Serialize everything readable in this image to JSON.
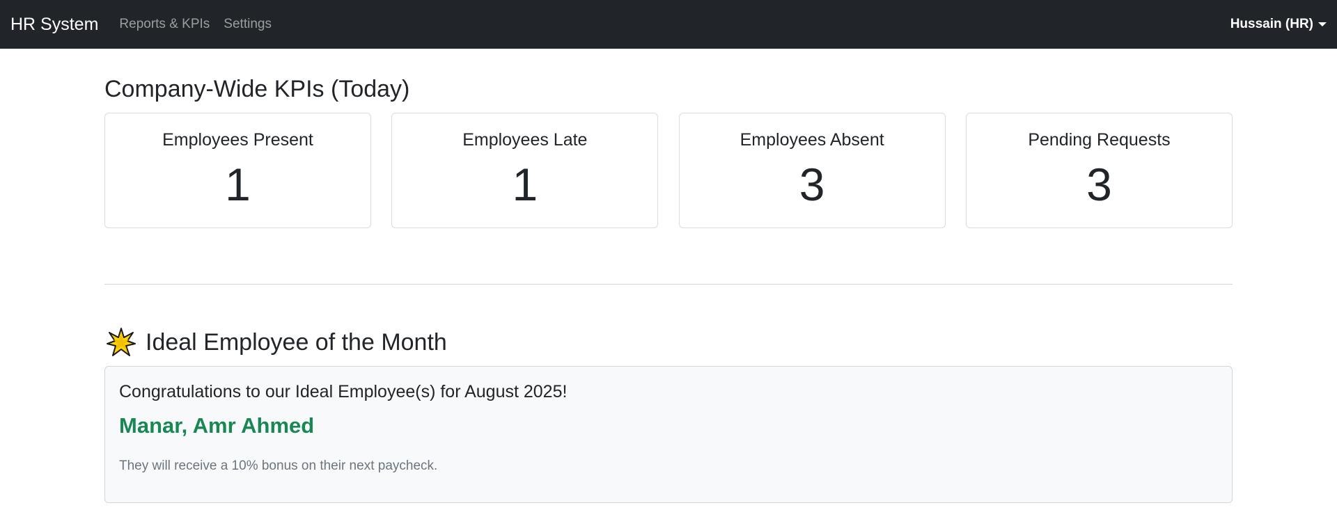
{
  "navbar": {
    "brand": "HR System",
    "links": [
      "Reports & KPIs",
      "Settings"
    ],
    "user": "Hussain (HR)"
  },
  "kpis": {
    "title": "Company-Wide KPIs (Today)",
    "cards": [
      {
        "label": "Employees Present",
        "value": "1"
      },
      {
        "label": "Employees Late",
        "value": "1"
      },
      {
        "label": "Employees Absent",
        "value": "3"
      },
      {
        "label": "Pending Requests",
        "value": "3"
      }
    ]
  },
  "ideal": {
    "icon": "star-icon",
    "title": "Ideal Employee of the Month",
    "congrats": "Congratulations to our Ideal Employee(s) for August 2025!",
    "names": "Manar, Amr Ahmed",
    "note": "They will receive a 10% bonus on their next paycheck."
  },
  "colors": {
    "navbar_bg": "#212529",
    "success_green": "#198754",
    "muted_text": "#6c757d",
    "star_fill": "#ffd400"
  }
}
